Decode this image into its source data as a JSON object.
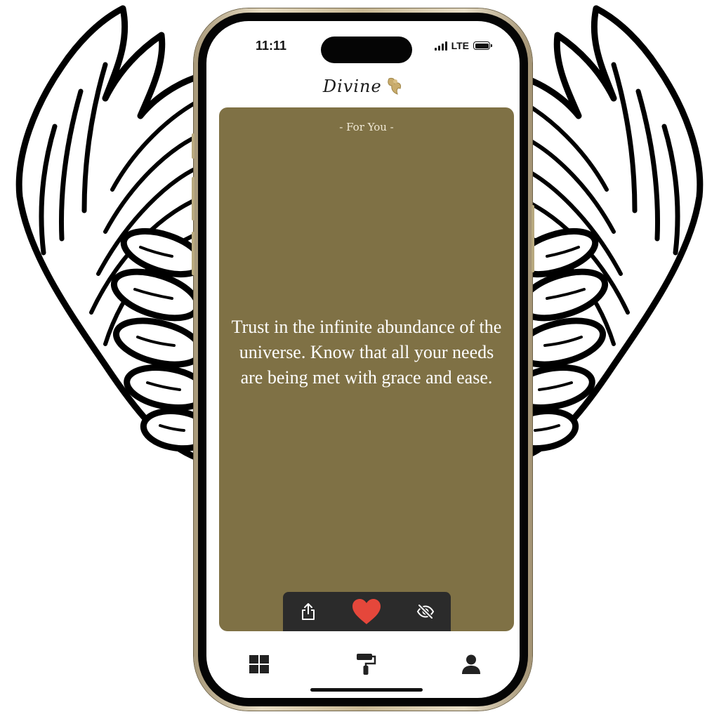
{
  "status_bar": {
    "time": "11:11",
    "network": "LTE",
    "signal_bars": 4,
    "battery_level": 1.0
  },
  "app": {
    "logo_text": "Divine",
    "logo_icon": "angel-icon",
    "accent_color": "#7f7145"
  },
  "card": {
    "tag": "- For You -",
    "quote": "Trust in the infinite abundance of the universe. Know that all your needs are being met with grace and ease.",
    "background_color": "#7f7145"
  },
  "actions": [
    {
      "name": "share",
      "icon": "share-icon"
    },
    {
      "name": "like",
      "icon": "heart-icon",
      "color": "#e5473b",
      "active": true
    },
    {
      "name": "hide",
      "icon": "eye-slash-icon"
    }
  ],
  "tabbar": [
    {
      "name": "categories",
      "icon": "grid-icon"
    },
    {
      "name": "themes",
      "icon": "paint-roller-icon"
    },
    {
      "name": "profile",
      "icon": "user-icon"
    }
  ],
  "decoration": {
    "background_art": "angel-wings",
    "device_frame": "gold"
  }
}
